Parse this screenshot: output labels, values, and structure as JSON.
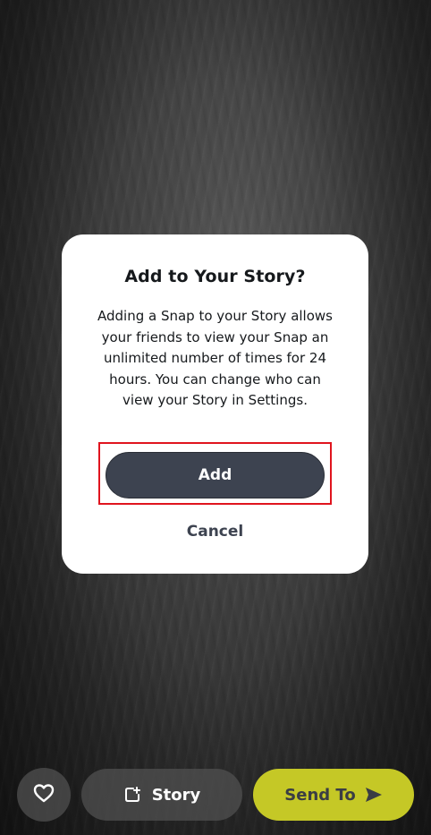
{
  "dialog": {
    "title": "Add to Your Story?",
    "message": "Adding a Snap to your Story allows your friends to view your Snap an unlimited number of times for 24 hours. You can change who can view your Story in Settings.",
    "add_label": "Add",
    "cancel_label": "Cancel",
    "highlight_color": "#e0141e"
  },
  "bottom_bar": {
    "heart_icon": "heart-icon",
    "story_icon": "add-story-icon",
    "story_label": "Story",
    "send_label": "Send To",
    "send_icon": "send-arrow-icon",
    "send_color": "#c5c826"
  }
}
